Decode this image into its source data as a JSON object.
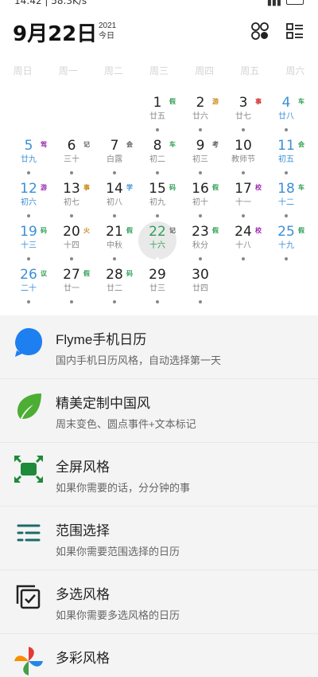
{
  "status_bar": {
    "time": "14:42",
    "net_speed": "58.3K/s",
    "battery": "55"
  },
  "header": {
    "date": "9月22日",
    "year": "2021",
    "today_label": "今日"
  },
  "weekdays": [
    "周日",
    "周一",
    "周二",
    "周三",
    "周四",
    "周五",
    "周六"
  ],
  "calendar": {
    "days": [
      {
        "d": "1",
        "l": "廿五",
        "tag": "假",
        "tc": "#2ea055"
      },
      {
        "d": "2",
        "l": "廿六",
        "tag": "游",
        "tc": "#c88a16"
      },
      {
        "d": "3",
        "l": "廿七",
        "tag": "事",
        "tc": "#d32f2f"
      },
      {
        "d": "4",
        "l": "廿八",
        "tag": "车",
        "tc": "#2ea055"
      },
      {
        "d": "5",
        "l": "廿九",
        "tag": "驾",
        "tc": "#9c27b0"
      },
      {
        "d": "6",
        "l": "三十",
        "tag": "记",
        "tc": "#555555"
      },
      {
        "d": "7",
        "l": "白露",
        "tag": "会",
        "tc": "#555555"
      },
      {
        "d": "8",
        "l": "初二",
        "tag": "车",
        "tc": "#2ea055"
      },
      {
        "d": "9",
        "l": "初三",
        "tag": "考",
        "tc": "#555555"
      },
      {
        "d": "10",
        "l": "教师节",
        "tag": "",
        "tc": ""
      },
      {
        "d": "11",
        "l": "初五",
        "tag": "会",
        "tc": "#2ea055"
      },
      {
        "d": "12",
        "l": "初六",
        "tag": "游",
        "tc": "#9c27b0"
      },
      {
        "d": "13",
        "l": "初七",
        "tag": "事",
        "tc": "#c88a16"
      },
      {
        "d": "14",
        "l": "初八",
        "tag": "学",
        "tc": "#3b8fd6"
      },
      {
        "d": "15",
        "l": "初九",
        "tag": "码",
        "tc": "#2ea055"
      },
      {
        "d": "16",
        "l": "初十",
        "tag": "假",
        "tc": "#2ea055"
      },
      {
        "d": "17",
        "l": "十一",
        "tag": "校",
        "tc": "#9c27b0"
      },
      {
        "d": "18",
        "l": "十二",
        "tag": "车",
        "tc": "#2ea055"
      },
      {
        "d": "19",
        "l": "十三",
        "tag": "码",
        "tc": "#2ea055"
      },
      {
        "d": "20",
        "l": "十四",
        "tag": "火",
        "tc": "#c88a16"
      },
      {
        "d": "21",
        "l": "中秋",
        "tag": "假",
        "tc": "#2ea055"
      },
      {
        "d": "22",
        "l": "十六",
        "tag": "记",
        "tc": "#555555"
      },
      {
        "d": "23",
        "l": "秋分",
        "tag": "假",
        "tc": "#2ea055"
      },
      {
        "d": "24",
        "l": "十八",
        "tag": "校",
        "tc": "#9c27b0"
      },
      {
        "d": "25",
        "l": "十九",
        "tag": "假",
        "tc": "#2ea055"
      },
      {
        "d": "26",
        "l": "二十",
        "tag": "议",
        "tc": "#2ea055"
      },
      {
        "d": "27",
        "l": "廿一",
        "tag": "假",
        "tc": "#2ea055"
      },
      {
        "d": "28",
        "l": "廿二",
        "tag": "码",
        "tc": "#2ea055"
      },
      {
        "d": "29",
        "l": "廿三",
        "tag": "",
        "tc": ""
      },
      {
        "d": "30",
        "l": "廿四",
        "tag": "",
        "tc": ""
      }
    ]
  },
  "styles": {
    "items": [
      {
        "title": "Flyme手机日历",
        "sub": "国内手机日历风格，自动选择第一天",
        "icon": "blue-drop-icon"
      },
      {
        "title": "精美定制中国风",
        "sub": "周末变色、圆点事件+文本标记",
        "icon": "green-leaf-icon"
      },
      {
        "title": "全屏风格",
        "sub": "如果你需要的话，分分钟的事",
        "icon": "fullscreen-icon"
      },
      {
        "title": "范围选择",
        "sub": "如果你需要范围选择的日历",
        "icon": "range-list-icon"
      },
      {
        "title": "多选风格",
        "sub": "如果你需要多选风格的日历",
        "icon": "multi-select-icon"
      },
      {
        "title": "多彩风格",
        "sub": "",
        "icon": "pinwheel-icon"
      }
    ]
  },
  "colors": {
    "accent_green": "#2ea055",
    "weekend_blue": "#3b8fd6",
    "list_bg": "#f4f4f4"
  }
}
